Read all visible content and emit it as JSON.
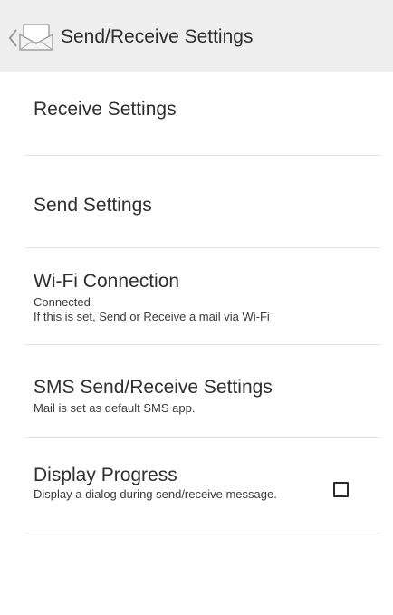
{
  "header": {
    "title": "Send/Receive Settings",
    "icons": {
      "back": "chevron-left-icon",
      "app": "mail-envelope-icon"
    }
  },
  "settings": [
    {
      "title": "Receive Settings"
    },
    {
      "title": "Send Settings"
    },
    {
      "title": "Wi-Fi Connection",
      "summary_status": "Connected",
      "summary_detail": "If this is set, Send or Receive a mail via Wi-Fi"
    },
    {
      "title": "SMS Send/Receive Settings",
      "summary": "Mail is set as default SMS app."
    },
    {
      "title": "Display Progress",
      "summary": "Display a dialog during send/receive message.",
      "checked": false
    }
  ],
  "colors": {
    "titlebar_bg": "#eeeeee",
    "text": "#2f2f2f",
    "divider": "#e4e4e4"
  }
}
